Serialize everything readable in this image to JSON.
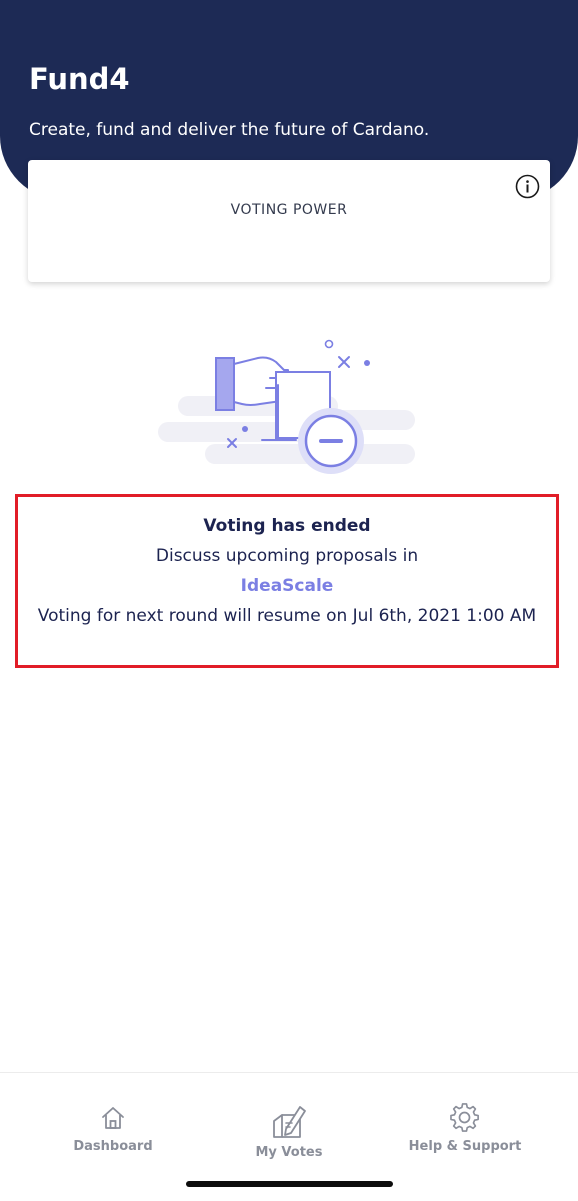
{
  "header": {
    "title": "Fund4",
    "subtitle": "Create, fund and deliver the future of Cardano."
  },
  "voting_power": {
    "label": "VOTING POWER",
    "info_icon": "info-circle-icon"
  },
  "illustration": {
    "icon": "ballot-hand-minus-icon"
  },
  "status": {
    "title": "Voting has ended",
    "discuss_text": "Discuss upcoming proposals in",
    "link_text": "IdeaScale",
    "resume_text": "Voting for next round will resume on Jul 6th, 2021 1:00 AM"
  },
  "nav": {
    "items": [
      {
        "label": "Dashboard",
        "icon": "home-icon"
      },
      {
        "label": "My Votes",
        "icon": "ballot-vote-icon"
      },
      {
        "label": "Help & Support",
        "icon": "gear-icon"
      }
    ]
  },
  "colors": {
    "header_bg": "#1d2a55",
    "accent": "#7b7fe3",
    "highlight_border": "#e11d27",
    "nav_label": "#8a8e99"
  }
}
